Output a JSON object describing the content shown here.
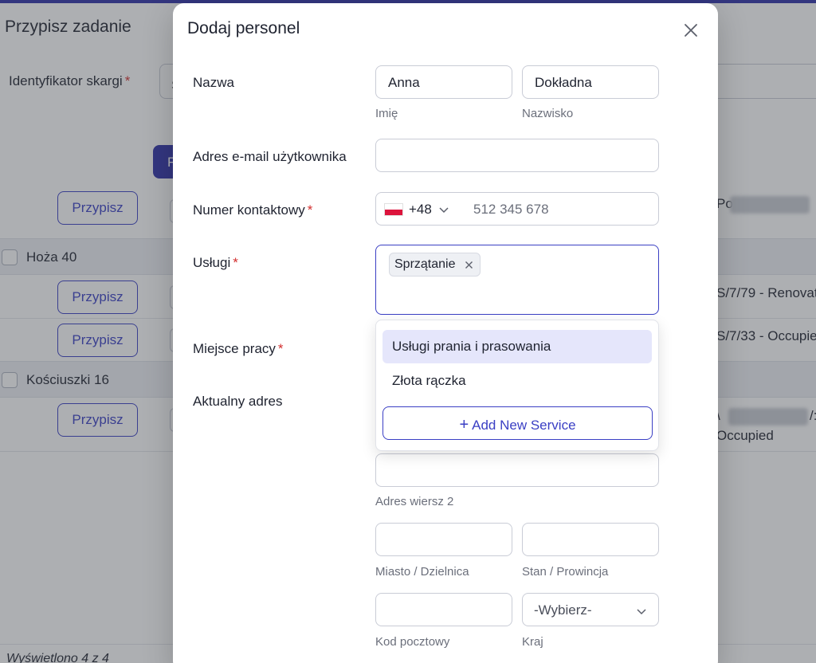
{
  "background": {
    "title": "Przypisz zadanie",
    "complaint_label": "Identyfikator skargi",
    "complaint_input_partial": "S",
    "button_partial": "F",
    "groups": [
      {
        "name": "Hoża 40"
      },
      {
        "name": "Kościuszki 16"
      }
    ],
    "assign_label": "Przypisz",
    "right_texts": {
      "row1_partial": "Po",
      "row2": "S/7/79 - Renovat",
      "row3": "S/7/33 - Occupie",
      "row4_line1": "\\",
      "row4_suffix": "/:",
      "row4_line2": "Occupied"
    },
    "footer": "Wyświetlono 4 z 4"
  },
  "modal": {
    "title": "Dodaj personel",
    "name": {
      "label": "Nazwa",
      "first_value": "Anna",
      "first_hint": "Imię",
      "last_value": "Dokładna",
      "last_hint": "Nazwisko"
    },
    "email": {
      "label": "Adres e-mail użytkownika",
      "value": ""
    },
    "phone": {
      "label": "Numer kontaktowy",
      "country_code": "+48",
      "placeholder": "512 345 678"
    },
    "services": {
      "label": "Usługi",
      "selected": [
        "Sprzątanie"
      ],
      "options": [
        "Usługi prania i prasowania",
        "Złota rączka"
      ],
      "add_new_label": "Add New Service"
    },
    "workplace": {
      "label": "Miejsce pracy"
    },
    "address": {
      "label": "Aktualny adres",
      "line2_hint": "Adres wiersz 2",
      "city_hint": "Miasto / Dzielnica",
      "state_hint": "Stan / Prowincja",
      "postal_hint": "Kod pocztowy",
      "country_hint": "Kraj",
      "country_value": "-Wybierz-"
    }
  },
  "colors": {
    "accent": "#3a3fc4",
    "required": "#d32f2f",
    "highlight": "#e5e6fb"
  }
}
